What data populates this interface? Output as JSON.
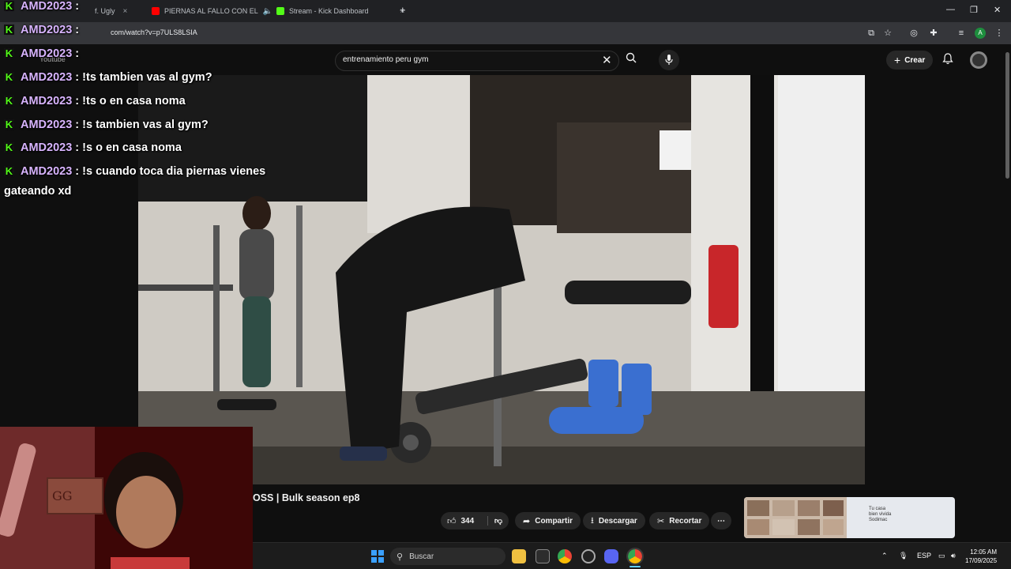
{
  "browser": {
    "tabs": [
      {
        "label": "f. Ugly",
        "close": "×"
      },
      {
        "label": "PIERNAS AL FALLO CON EL",
        "close": "×"
      },
      {
        "label": "Stream - Kick Dashboard",
        "close": "×"
      }
    ],
    "new_tab": "+",
    "url": "com/watch?v=p7ULS8LSIA",
    "window_controls": {
      "minimize": "—",
      "maximize": "❐",
      "close": "✕"
    }
  },
  "youtube": {
    "logo_text": "Youtube",
    "search_query": "entrenamiento peru gym",
    "create_label": "Crear",
    "video_title": "OSS | Bulk season ep8",
    "like_count": "344",
    "share_label": "Compartir",
    "download_label": "Descargar",
    "clip_label": "Recortar",
    "more_label": "⋯",
    "ad_text_line1": "Tu casa",
    "ad_text_line2": "bien vivida",
    "ad_text_line3": "Sodimac"
  },
  "chat": {
    "messages": [
      {
        "user": "AMD2023",
        "sep": " :",
        "text": ""
      },
      {
        "user": "AMD2023",
        "sep": " :",
        "text": ""
      },
      {
        "user": "AMD2023",
        "sep": " :",
        "text": ""
      },
      {
        "user": "AMD2023",
        "sep": " : ",
        "text": "!ts tambien vas al gym?"
      },
      {
        "user": "AMD2023",
        "sep": " : ",
        "text": "!ts o en casa noma"
      },
      {
        "user": "AMD2023",
        "sep": " : ",
        "text": "!s tambien vas al gym?"
      },
      {
        "user": "AMD2023",
        "sep": " : ",
        "text": "!s o en casa noma"
      },
      {
        "user": "AMD2023",
        "sep": " : ",
        "text": "!s cuando toca dia piernas vienes"
      }
    ],
    "wrap_line": "gateando xd",
    "badge": "K"
  },
  "webcam": {
    "sign_text": "GG"
  },
  "taskbar": {
    "search_label": "Buscar",
    "language": "ESP",
    "time": "12:05 AM",
    "date": "17/09/2025"
  },
  "colors": {
    "kick_green": "#53fc18",
    "chat_user": "#d8b4fe",
    "youtube_red": "#ff0000"
  }
}
